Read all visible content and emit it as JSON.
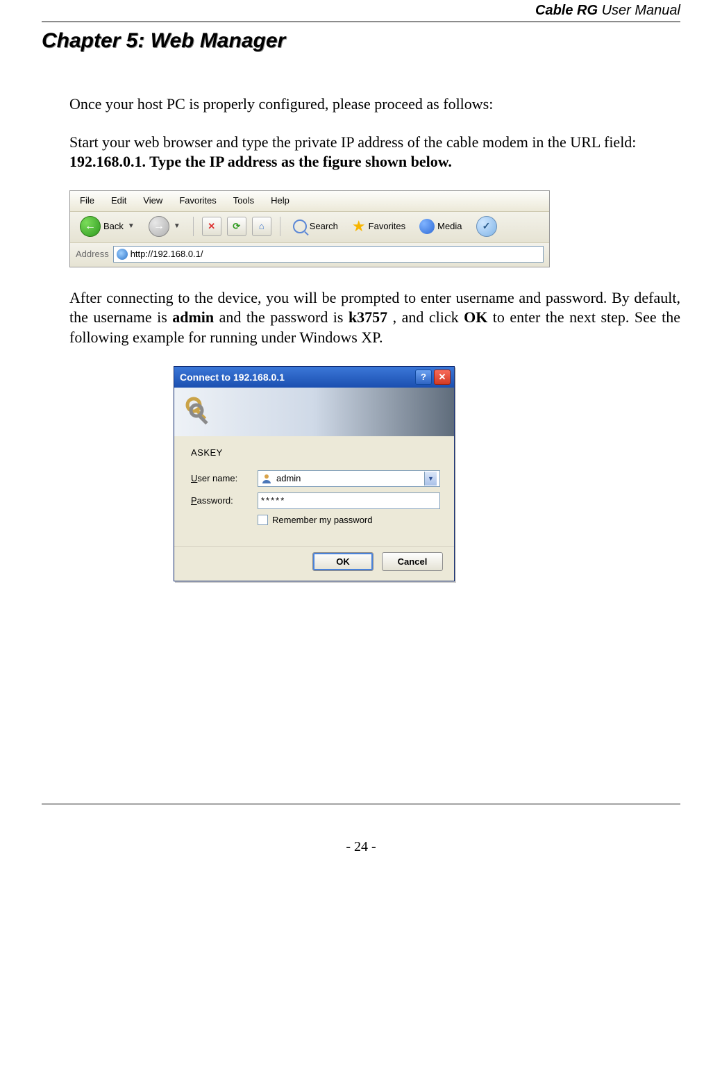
{
  "header": {
    "product": "Cable RG",
    "suffix": "User Manual"
  },
  "chapter_title": "Chapter 5: Web Manager",
  "para1": "Once your host PC is properly configured, please proceed as follows:",
  "para2_lead": "Start your web browser and type the private IP address of the cable modem in the URL field: ",
  "ip_bold": "192.168.0.1.    Type the IP address as the figure shown below.",
  "browser": {
    "menu": [
      "File",
      "Edit",
      "View",
      "Favorites",
      "Tools",
      "Help"
    ],
    "back_label": "Back",
    "search_label": "Search",
    "favorites_label": "Favorites",
    "media_label": "Media",
    "address_label": "Address",
    "address_value": "http://192.168.0.1/"
  },
  "para3_a": "After connecting to the device, you will be prompted to enter username and password. By default, the username is ",
  "para3_admin": "admin",
  "para3_b": " and the password is ",
  "para3_pw": "k3757",
  "para3_c": ", and click ",
  "para3_ok": "OK",
  "para3_d": " to enter the next step.    See the following example for running under Windows XP.",
  "dialog": {
    "title": "Connect to 192.168.0.1",
    "realm": "ASKEY",
    "user_label_u": "U",
    "user_label_rest": "ser name:",
    "pass_label_u": "P",
    "pass_label_rest": "assword:",
    "user_value": "admin",
    "pass_value": "*****",
    "remember_u": "R",
    "remember_rest": "emember my password",
    "ok": "OK",
    "cancel": "Cancel"
  },
  "page_number": "- 24 -"
}
